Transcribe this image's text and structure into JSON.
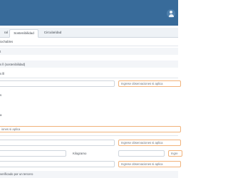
{
  "tabs": {
    "general": "ral",
    "sustainability": "Sostenibilidad",
    "circularity": "Circularidad"
  },
  "rows": {
    "r1": "iochables",
    "r2": "t",
    "r3": "s ll (sostenibilidad)",
    "r4": "s lll",
    "r5": "s",
    "r6": "a"
  },
  "inputs": {
    "obs_placeholder": "Ingrese observaciones si aplica",
    "obs_placeholder_cut": "iones si aplica",
    "obs_placeholder_short": "Ingre",
    "unit_label": "Kilogramo"
  },
  "footer": {
    "verified_text": "verificado por un tercero"
  }
}
